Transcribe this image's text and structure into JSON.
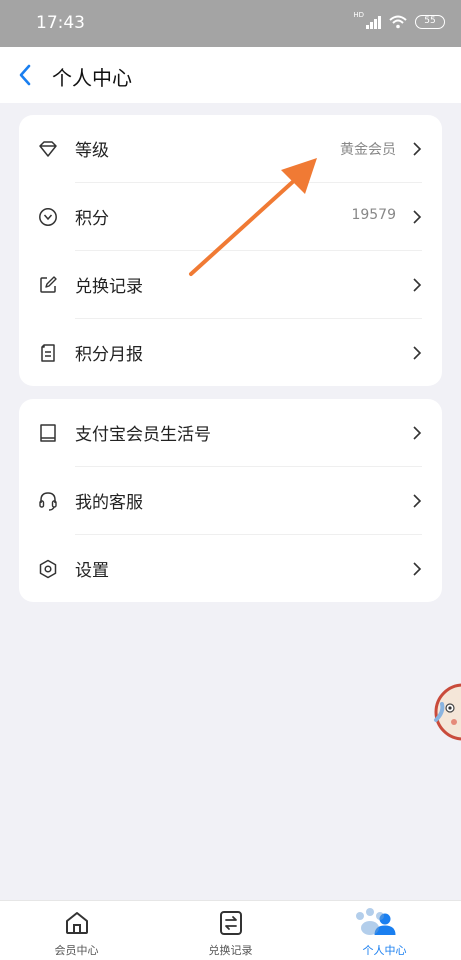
{
  "status_bar": {
    "time": "17:43",
    "network": "HD",
    "battery": "55"
  },
  "nav": {
    "title": "个人中心"
  },
  "group1": [
    {
      "label": "等级",
      "value": "黄金会员",
      "icon": "diamond-icon"
    },
    {
      "label": "积分",
      "value": "19579",
      "icon": "points-icon"
    },
    {
      "label": "兑换记录",
      "value": "",
      "icon": "edit-icon"
    },
    {
      "label": "积分月报",
      "value": "",
      "icon": "report-icon"
    }
  ],
  "group2": [
    {
      "label": "支付宝会员生活号",
      "icon": "bookmark-icon"
    },
    {
      "label": "我的客服",
      "icon": "headset-icon"
    },
    {
      "label": "设置",
      "icon": "settings-icon"
    }
  ],
  "tabs": [
    {
      "label": "会员中心",
      "icon": "home-icon"
    },
    {
      "label": "兑换记录",
      "icon": "exchange-icon"
    },
    {
      "label": "个人中心",
      "icon": "person-icon",
      "active": true
    }
  ],
  "colors": {
    "accent": "#1a7ff0",
    "arrow": "#f07a34",
    "status_bar": "#a4a4a4",
    "background": "#f1f1f6"
  }
}
